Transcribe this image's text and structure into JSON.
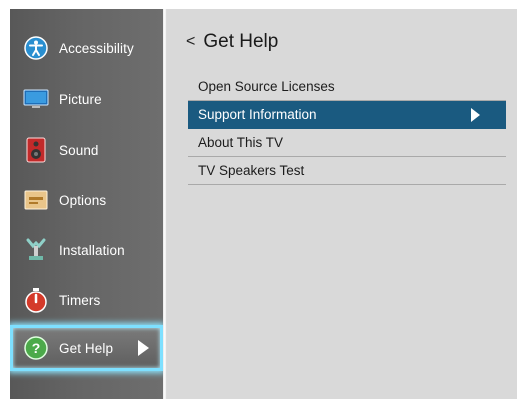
{
  "sidebar": {
    "items": [
      {
        "label": "Accessibility",
        "icon": "accessibility-icon"
      },
      {
        "label": "Picture",
        "icon": "picture-icon"
      },
      {
        "label": "Sound",
        "icon": "sound-icon"
      },
      {
        "label": "Options",
        "icon": "options-icon"
      },
      {
        "label": "Installation",
        "icon": "installation-icon"
      },
      {
        "label": "Timers",
        "icon": "timers-icon"
      },
      {
        "label": "Get Help",
        "icon": "help-icon",
        "active": true
      }
    ]
  },
  "main": {
    "back": "<",
    "title": "Get Help",
    "menu": [
      {
        "label": "Open Source Licenses"
      },
      {
        "label": "Support Information",
        "selected": true
      },
      {
        "label": "About This TV"
      },
      {
        "label": "TV Speakers Test"
      }
    ]
  },
  "colors": {
    "selection": "#1a5a80",
    "focus_glow": "#7ee0ff",
    "sidebar_bg": "#656565",
    "panel_bg": "#d9d9d9"
  }
}
